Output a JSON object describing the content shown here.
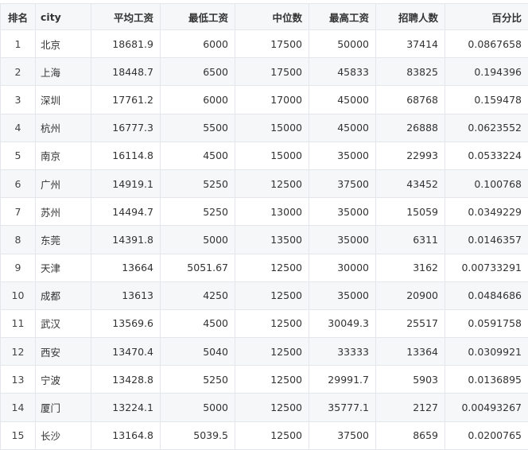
{
  "table": {
    "headers": {
      "rank": "排名",
      "city": "city",
      "avg": "平均工资",
      "min": "最低工资",
      "median": "中位数",
      "max": "最高工资",
      "hires": "招聘人数",
      "percent": "百分比"
    },
    "rows": [
      {
        "rank": "1",
        "city": "北京",
        "avg": "18681.9",
        "min": "6000",
        "median": "17500",
        "max": "50000",
        "hires": "37414",
        "percent": "0.0867658"
      },
      {
        "rank": "2",
        "city": "上海",
        "avg": "18448.7",
        "min": "6500",
        "median": "17500",
        "max": "45833",
        "hires": "83825",
        "percent": "0.194396"
      },
      {
        "rank": "3",
        "city": "深圳",
        "avg": "17761.2",
        "min": "6000",
        "median": "17000",
        "max": "45000",
        "hires": "68768",
        "percent": "0.159478"
      },
      {
        "rank": "4",
        "city": "杭州",
        "avg": "16777.3",
        "min": "5500",
        "median": "15000",
        "max": "45000",
        "hires": "26888",
        "percent": "0.0623552"
      },
      {
        "rank": "5",
        "city": "南京",
        "avg": "16114.8",
        "min": "4500",
        "median": "15000",
        "max": "35000",
        "hires": "22993",
        "percent": "0.0533224"
      },
      {
        "rank": "6",
        "city": "广州",
        "avg": "14919.1",
        "min": "5250",
        "median": "12500",
        "max": "37500",
        "hires": "43452",
        "percent": "0.100768"
      },
      {
        "rank": "7",
        "city": "苏州",
        "avg": "14494.7",
        "min": "5250",
        "median": "13000",
        "max": "35000",
        "hires": "15059",
        "percent": "0.0349229"
      },
      {
        "rank": "8",
        "city": "东莞",
        "avg": "14391.8",
        "min": "5000",
        "median": "13500",
        "max": "35000",
        "hires": "6311",
        "percent": "0.0146357"
      },
      {
        "rank": "9",
        "city": "天津",
        "avg": "13664",
        "min": "5051.67",
        "median": "12500",
        "max": "30000",
        "hires": "3162",
        "percent": "0.00733291"
      },
      {
        "rank": "10",
        "city": "成都",
        "avg": "13613",
        "min": "4250",
        "median": "12500",
        "max": "35000",
        "hires": "20900",
        "percent": "0.0484686"
      },
      {
        "rank": "11",
        "city": "武汉",
        "avg": "13569.6",
        "min": "4500",
        "median": "12500",
        "max": "30049.3",
        "hires": "25517",
        "percent": "0.0591758"
      },
      {
        "rank": "12",
        "city": "西安",
        "avg": "13470.4",
        "min": "5040",
        "median": "12500",
        "max": "33333",
        "hires": "13364",
        "percent": "0.0309921"
      },
      {
        "rank": "13",
        "city": "宁波",
        "avg": "13428.8",
        "min": "5250",
        "median": "12500",
        "max": "29991.7",
        "hires": "5903",
        "percent": "0.0136895"
      },
      {
        "rank": "14",
        "city": "厦门",
        "avg": "13224.1",
        "min": "5000",
        "median": "12500",
        "max": "35777.1",
        "hires": "2127",
        "percent": "0.00493267"
      },
      {
        "rank": "15",
        "city": "长沙",
        "avg": "13164.8",
        "min": "5039.5",
        "median": "12500",
        "max": "37500",
        "hires": "8659",
        "percent": "0.0200765"
      }
    ]
  }
}
